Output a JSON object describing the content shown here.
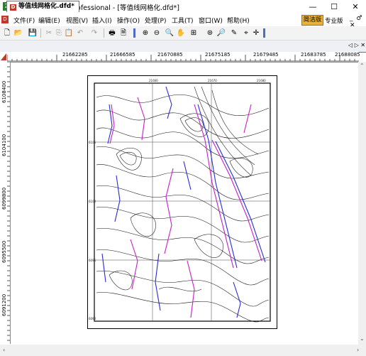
{
  "window": {
    "title": "DoubleFoxDraw Professional - [等值线网格化.dfd*]",
    "icon": "app-icon"
  },
  "window_controls": {
    "minimize": "—",
    "maximize": "☐",
    "close": "✕"
  },
  "menu": [
    "文件(F)",
    "编辑(E)",
    "视图(V)",
    "插入(I)",
    "操作(O)",
    "处理(P)",
    "工具(T)",
    "窗口(W)",
    "帮助(H)"
  ],
  "edition": {
    "simple": "简洁版",
    "pro": "专业版",
    "mdi_controls": "_ ♂ ✕"
  },
  "tab": {
    "label": "等值线网格化.dfd*",
    "controls": "◁ ▷ ✕"
  },
  "ruler": {
    "x_labels": [
      "21662285",
      "21666585",
      "21670885",
      "21675185",
      "21679485",
      "21683785",
      "21688085"
    ],
    "y_labels": [
      "6108400",
      "6104100",
      "6099800",
      "6095500",
      "6091200"
    ]
  },
  "map_frame_labels": [
    "21660",
    "21670",
    "21680",
    "6105",
    "6100",
    "6095",
    "6090"
  ],
  "colors": {
    "accent": "#4d6cc8",
    "contour": "#000000",
    "fault_blue": "#2a2ad6",
    "fault_magenta": "#c81ec8"
  }
}
